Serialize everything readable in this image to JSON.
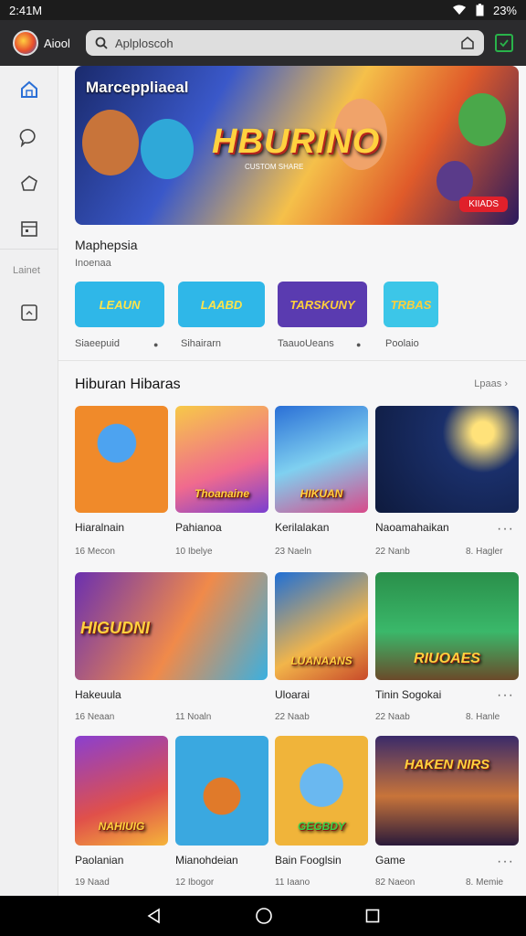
{
  "status_bar": {
    "time": "2:41M",
    "battery": "23%"
  },
  "app_bar": {
    "name": "Aiool",
    "search_text": "Aplploscoh"
  },
  "sidebar": {
    "label": "Lainet"
  },
  "banner": {
    "title": "Marceppliaeal",
    "logo": "HBURINO",
    "subtitle": "CUSTOM SHARE",
    "badge": "KIIADS"
  },
  "section": {
    "title": "Maphepsia",
    "subtitle": "Inoenaa"
  },
  "chips": [
    {
      "text": "LEAUN",
      "label": "Siaeepuid",
      "color": "#2fb7e8"
    },
    {
      "text": "LAABD",
      "label": "Sihairarn",
      "color": "#2fb7e8"
    },
    {
      "text": "TARSKUNY",
      "label": "TaauoUeans",
      "color": "#5a3bb0"
    },
    {
      "text": "TRBAS",
      "label": "Poolaio",
      "color": "#3cc6e8"
    }
  ],
  "grid": {
    "title": "Hiburan Hibaras",
    "more": "Lpaas",
    "games": [
      {
        "name": "Hiaralnain",
        "meta": "16 Mecon",
        "extra": "",
        "tile_text": ""
      },
      {
        "name": "Pahianoa",
        "meta": "10 Ibelye",
        "extra": "",
        "tile_text": "Thoanaine"
      },
      {
        "name": "Kerilalakan",
        "meta": "23 Naeln",
        "extra": "",
        "tile_text": "HIKUAN"
      },
      {
        "name": "Naoamahaikan",
        "meta": "22 Nanb",
        "extra": "8. Hagler",
        "tile_text": ""
      },
      {
        "name": "Hakeuula",
        "meta": "16 Neaan",
        "extra": "",
        "tile_text": "HIGUDNI"
      },
      {
        "name": "Uloarai",
        "meta": "11 Noaln",
        "extra": "",
        "tile_text": "LUANAANS"
      },
      {
        "name": "Tinin Sogokai",
        "meta": "22 Naab",
        "extra": "8. Hanle",
        "tile_text": "RIUOAES"
      },
      {
        "name": "Paolanian",
        "meta": "19 Naad",
        "extra": "",
        "tile_text": "NAHIUIG"
      },
      {
        "name": "Mianohdeian",
        "meta": "12 Ibogor",
        "extra": "",
        "tile_text": ""
      },
      {
        "name": "Bain Fooglsin",
        "meta": "11 Iaano",
        "extra": "",
        "tile_text": "GEGBDY"
      },
      {
        "name": "Game",
        "meta": "82 Naeon",
        "extra": "8. Memie",
        "tile_text": "HAKEN NIRS"
      }
    ]
  },
  "colors": {
    "accent": "#2a6fd6",
    "status_bar": "#1c1c1c",
    "app_bar": "#2b2b2d",
    "badge": "#e0202a"
  }
}
